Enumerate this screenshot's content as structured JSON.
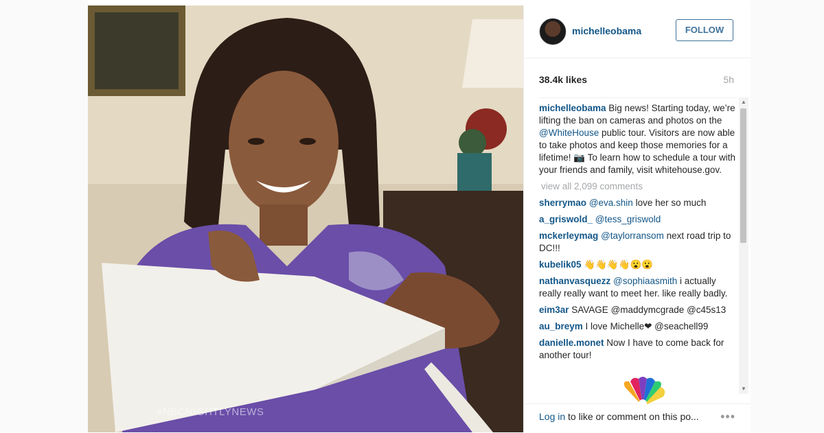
{
  "photo": {
    "watermark": "#NBCNIGHTLYNEWS"
  },
  "post": {
    "username": "michelleobama",
    "follow_label": "FOLLOW",
    "likes": "38.4k likes",
    "time": "5h",
    "caption_user": "michelleobama",
    "caption_1": " Big news! Starting today, we’re lifting the ban on cameras and photos on the ",
    "caption_tag": "@WhiteHouse",
    "caption_2": " public tour. Visitors are now able to take photos and keep those memories for a lifetime! 📷 To learn how to schedule a tour with your friends and family, visit whitehouse.gov.",
    "view_all": "view all 2,099 comments"
  },
  "comments": [
    {
      "user": "sherrymao",
      "tag": "@eva.shin",
      "text": " love her so much"
    },
    {
      "user": "a_griswold_",
      "tag": "@tess_griswold",
      "text": ""
    },
    {
      "user": "mckerleymag",
      "tag": "@taylorransom",
      "text": " next road trip to DC!!!"
    },
    {
      "user": "kubelik05",
      "tag": "",
      "text": " 👋👋👋👋😮😮"
    },
    {
      "user": "nathanvasquezz",
      "tag": "@sophiaasmith",
      "text": " i actually really really want to meet her. like really badly."
    },
    {
      "user": "eim3ar",
      "tag": "",
      "text": " SAVAGE @maddymcgrade @c45s13"
    },
    {
      "user": "au_breym",
      "tag": "",
      "text": " I love Michelle❤ @seachell99"
    },
    {
      "user": "danielle.monet",
      "tag": "",
      "text": " Now I have to come back for another tour!"
    }
  ],
  "footer": {
    "login_link": "Log in",
    "login_text": " to like or comment on this po...",
    "more_icon": "•••"
  },
  "colors": {
    "link": "#125688",
    "follow": "#3f729b",
    "muted": "#a5a7aa"
  }
}
